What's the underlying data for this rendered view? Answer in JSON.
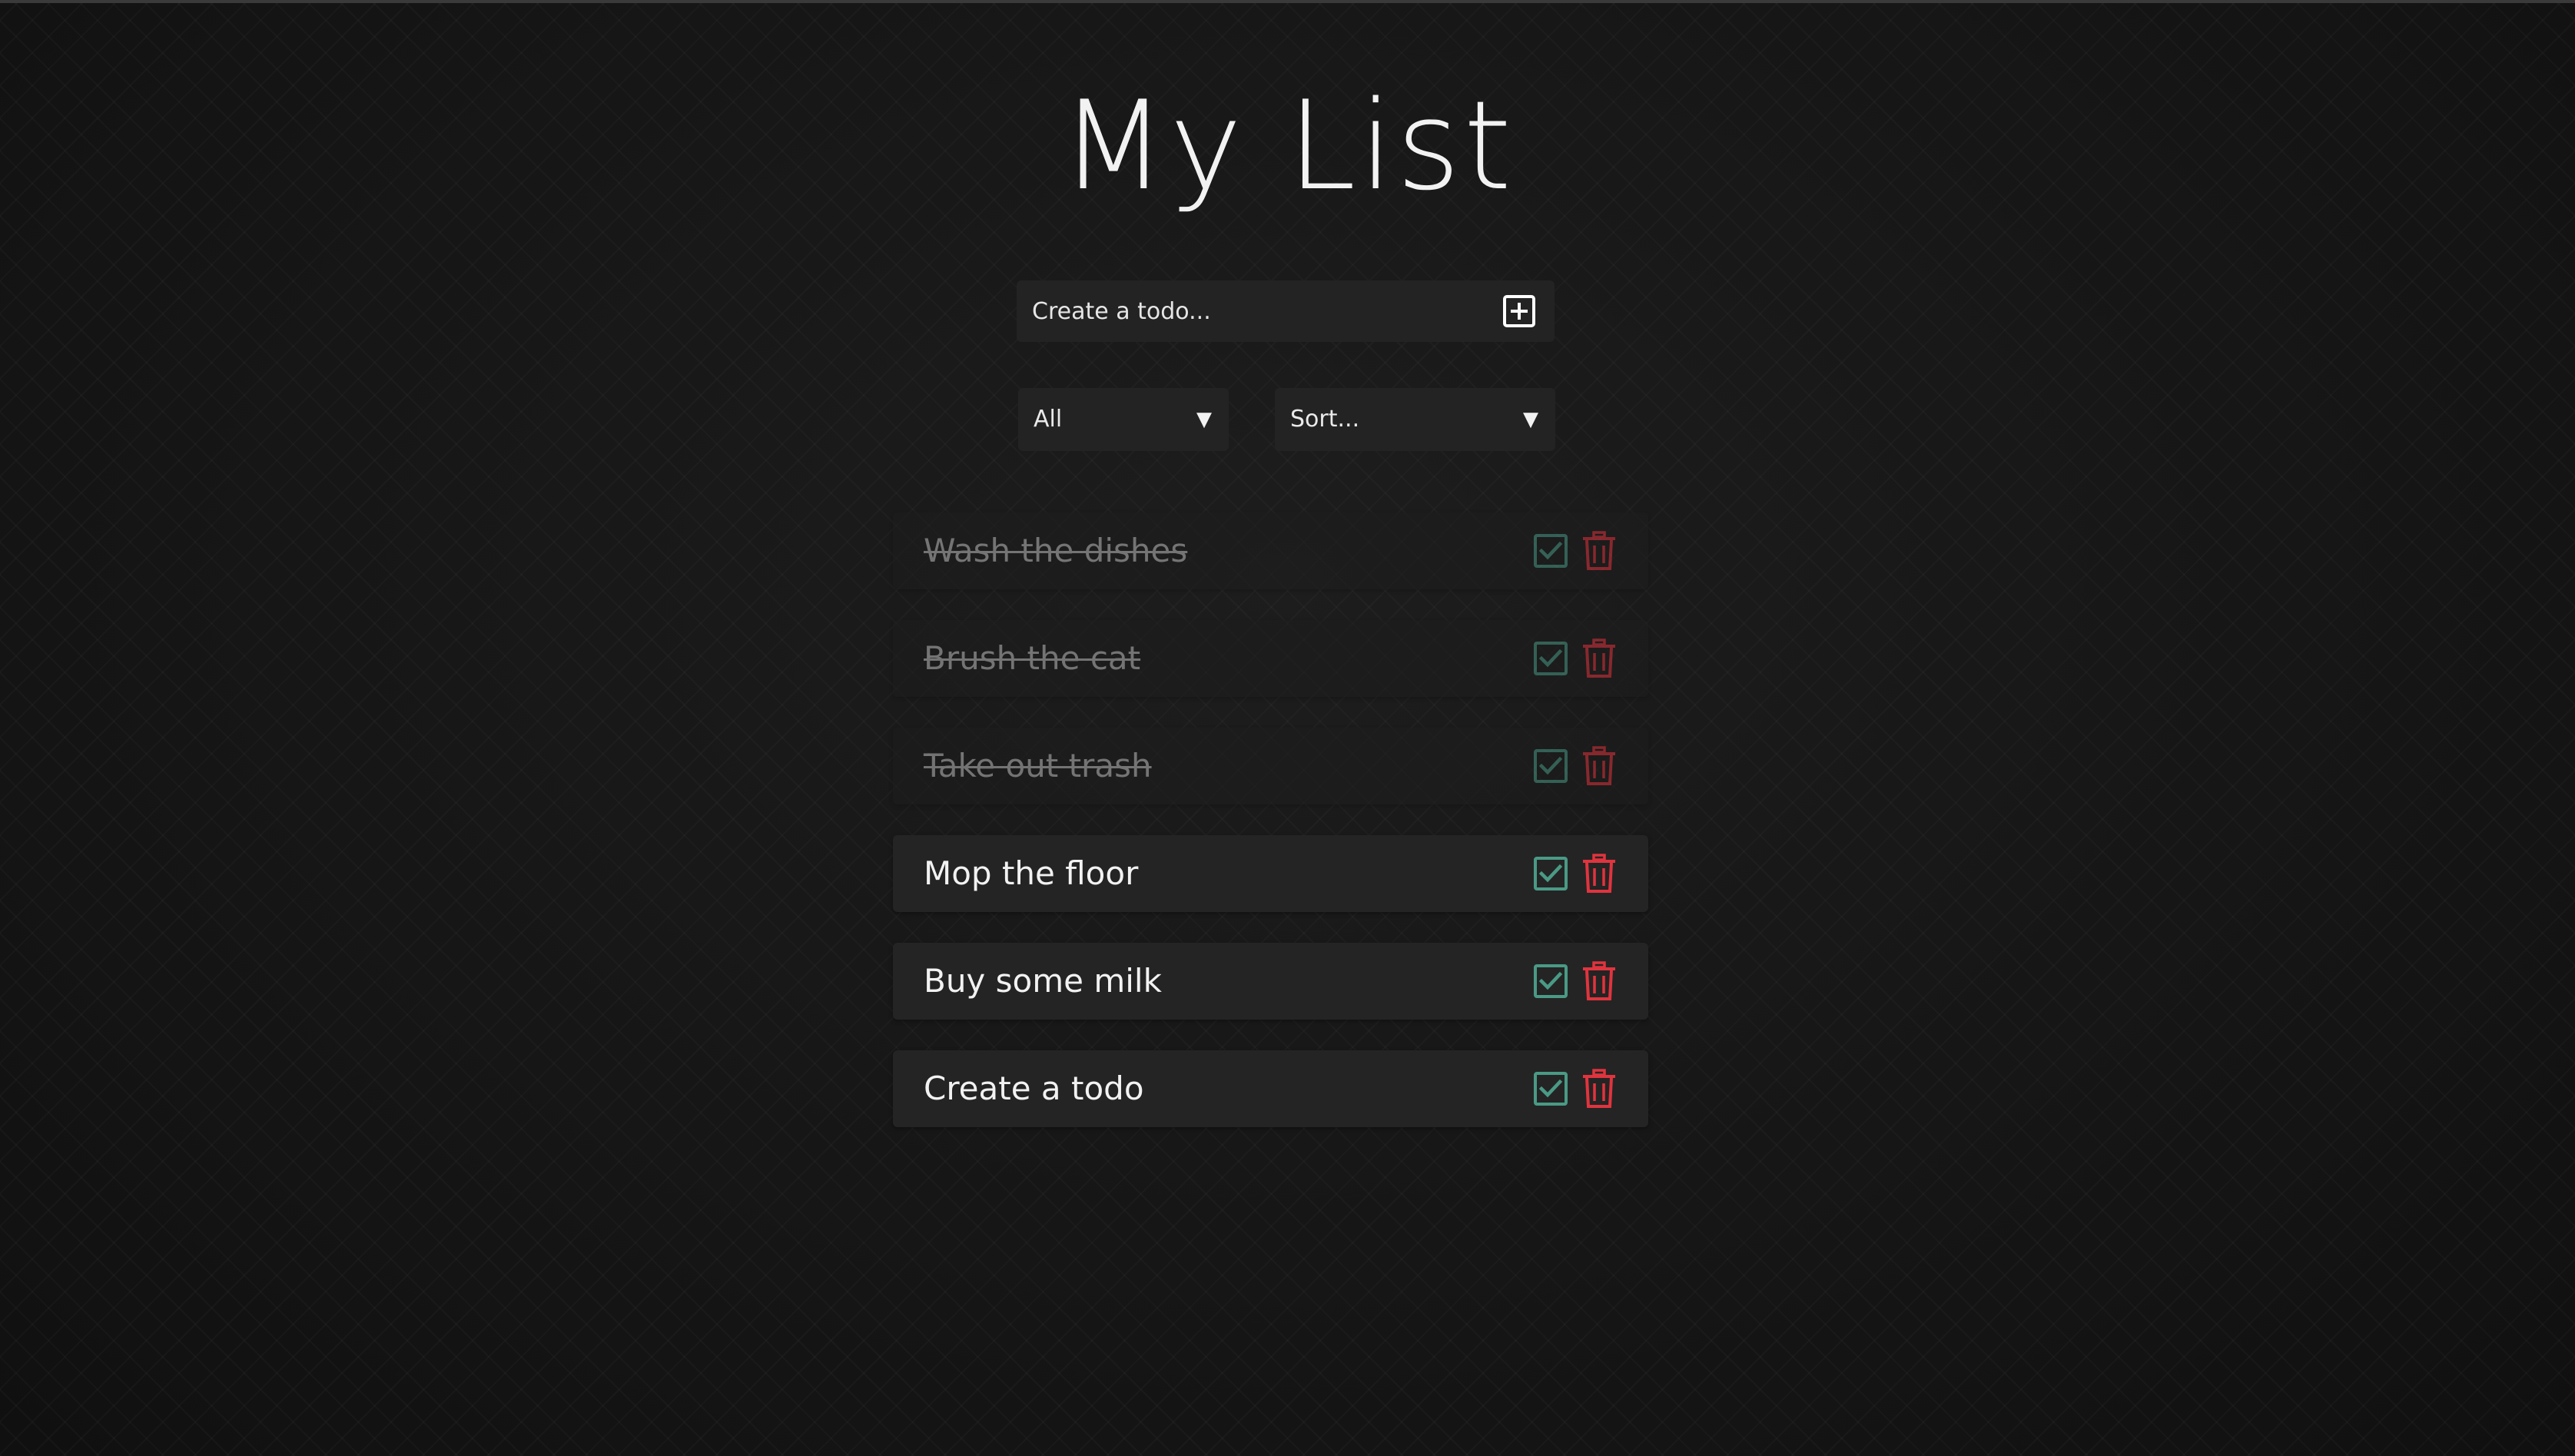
{
  "page": {
    "title": "My List"
  },
  "create": {
    "placeholder": "Create a todo...",
    "add_icon": "plus-square-icon"
  },
  "filters": {
    "status_selected": "All",
    "sort_selected": "Sort..."
  },
  "colors": {
    "check": "#4a9a85",
    "trash": "#e0343e",
    "background": "#171717",
    "card": "#242424"
  },
  "todos": [
    {
      "text": "Wash the dishes",
      "completed": true
    },
    {
      "text": "Brush the cat",
      "completed": true
    },
    {
      "text": "Take out trash",
      "completed": true
    },
    {
      "text": "Mop the floor",
      "completed": false
    },
    {
      "text": "Buy some milk",
      "completed": false
    },
    {
      "text": "Create a todo",
      "completed": false
    }
  ]
}
